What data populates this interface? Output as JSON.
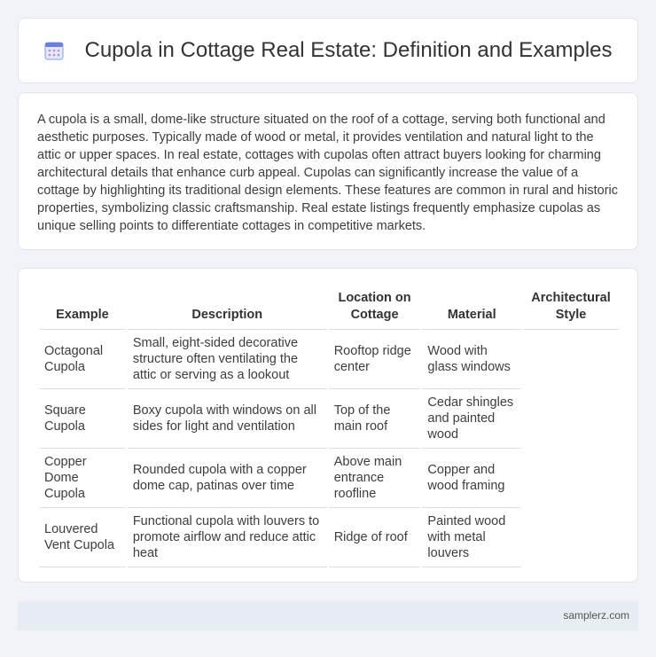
{
  "header": {
    "title": "Cupola in Cottage Real Estate: Definition and Examples",
    "icon": "calendar-icon",
    "accent_color": "#6b7fe0"
  },
  "intro": {
    "text": "A cupola is a small, dome-like structure situated on the roof of a cottage, serving both functional and aesthetic purposes. Typically made of wood or metal, it provides ventilation and natural light to the attic or upper spaces. In real estate, cottages with cupolas often attract buyers looking for charming architectural details that enhance curb appeal. Cupolas can significantly increase the value of a cottage by highlighting its traditional design elements. These features are common in rural and historic properties, symbolizing classic craftsmanship. Real estate listings frequently emphasize cupolas as unique selling points to differentiate cottages in competitive markets."
  },
  "table": {
    "headers": [
      "Example",
      "Description",
      "Location on Cottage",
      "Material",
      "Architectural Style"
    ],
    "rows": [
      [
        "Octagonal Cupola",
        "Small, eight-sided decorative structure often ventilating the attic or serving as a lookout",
        "Rooftop ridge center",
        "Wood with glass windows"
      ],
      [
        "Square Cupola",
        "Boxy cupola with windows on all sides for light and ventilation",
        "Top of the main roof",
        "Cedar shingles and painted wood"
      ],
      [
        "Copper Dome Cupola",
        "Rounded cupola with a copper dome cap, patinas over time",
        "Above main entrance roofline",
        "Copper and wood framing"
      ],
      [
        "Louvered Vent Cupola",
        "Functional cupola with louvers to promote airflow and reduce attic heat",
        "Ridge of roof",
        "Painted wood with metal louvers"
      ]
    ]
  },
  "footer": {
    "text": "samplerz.com"
  }
}
